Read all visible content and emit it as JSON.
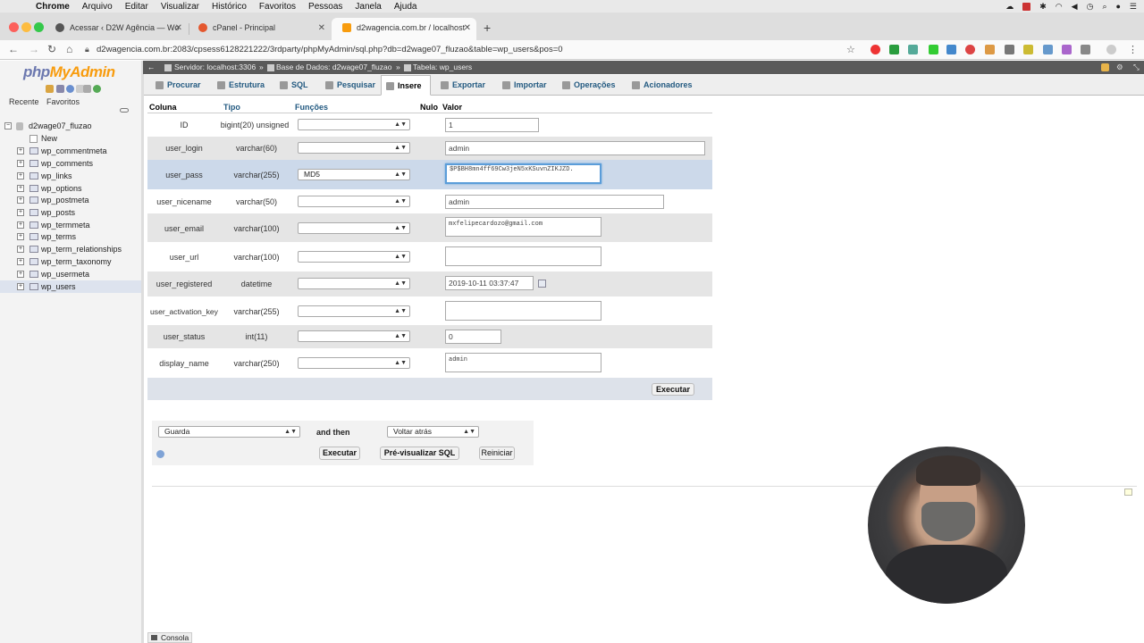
{
  "mac_menu": {
    "app": "Chrome",
    "items": [
      "Arquivo",
      "Editar",
      "Visualizar",
      "Histórico",
      "Favoritos",
      "Pessoas",
      "Janela",
      "Ajuda"
    ]
  },
  "browser": {
    "tabs": [
      {
        "label": "Acessar ‹ D2W Agência — Wo"
      },
      {
        "label": "cPanel - Principal"
      },
      {
        "label": "d2wagencia.com.br / localhost"
      }
    ],
    "new_tab": "+",
    "url": "d2wagencia.com.br:2083/cpsess6128221222/3rdparty/phpMyAdmin/sql.php?db=d2wage07_fluzao&table=wp_users&pos=0"
  },
  "pma": {
    "logo_php": "php",
    "logo_my": "MyAdmin",
    "left_tabs": [
      "Recente",
      "Favoritos"
    ],
    "database": "d2wage07_fluzao",
    "new_label": "New",
    "tables": [
      "wp_commentmeta",
      "wp_comments",
      "wp_links",
      "wp_options",
      "wp_postmeta",
      "wp_posts",
      "wp_termmeta",
      "wp_terms",
      "wp_term_relationships",
      "wp_term_taxonomy",
      "wp_usermeta",
      "wp_users"
    ],
    "breadcrumb": {
      "server": "Servidor: localhost:3306",
      "database": "Base de Dados: d2wage07_fluzao",
      "table": "Tabela: wp_users"
    },
    "nav_tabs": [
      "Procurar",
      "Estrutura",
      "SQL",
      "Pesquisar",
      "Insere",
      "Exportar",
      "Importar",
      "Operações",
      "Acionadores"
    ],
    "headers": {
      "column": "Coluna",
      "type": "Tipo",
      "functions": "Funções",
      "null": "Nulo",
      "value": "Valor"
    },
    "rows": [
      {
        "name": "ID",
        "type": "bigint(20) unsigned",
        "func": "",
        "value": "1"
      },
      {
        "name": "user_login",
        "type": "varchar(60)",
        "func": "",
        "value": "admin"
      },
      {
        "name": "user_pass",
        "type": "varchar(255)",
        "func": "MD5",
        "value": "$P$BH8mn4ff69Cw3jeN5xKSuvnZIKJZD."
      },
      {
        "name": "user_nicename",
        "type": "varchar(50)",
        "func": "",
        "value": "admin"
      },
      {
        "name": "user_email",
        "type": "varchar(100)",
        "func": "",
        "value": "mxfelipecardozo@gmail.com"
      },
      {
        "name": "user_url",
        "type": "varchar(100)",
        "func": "",
        "value": ""
      },
      {
        "name": "user_registered",
        "type": "datetime",
        "func": "",
        "value": "2019-10-11 03:37:47"
      },
      {
        "name": "user_activation_key",
        "type": "varchar(255)",
        "func": "",
        "value": ""
      },
      {
        "name": "user_status",
        "type": "int(11)",
        "func": "",
        "value": "0"
      },
      {
        "name": "display_name",
        "type": "varchar(250)",
        "func": "",
        "value": "admin"
      }
    ],
    "execute_label": "Executar",
    "action": {
      "save_select": "Guarda",
      "and_then": "and then",
      "after_select": "Voltar atrás",
      "execute": "Executar",
      "preview": "Pré-visualizar SQL",
      "reset": "Reiniciar"
    },
    "console": "Consola"
  },
  "colors": {
    "accent": "#235a81",
    "highlight_row": "#ccd9ea",
    "focus": "#5b9dd9",
    "crumb_bg": "#5a5a5a"
  }
}
